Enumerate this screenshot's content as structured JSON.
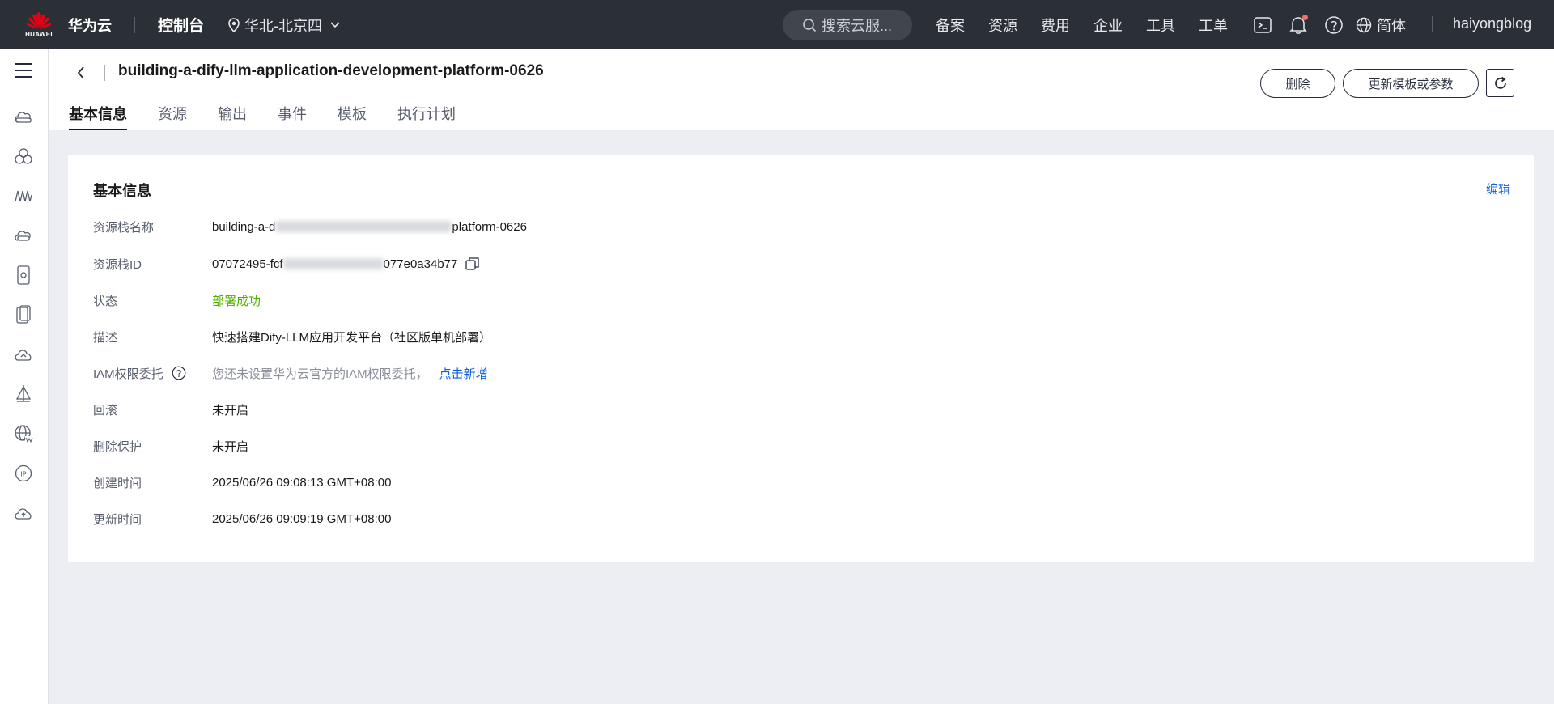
{
  "topbar": {
    "logo_text": "HUAWEI",
    "brand": "华为云",
    "console": "控制台",
    "region": "华北-北京四",
    "search_placeholder": "搜索云服...",
    "nav_links": [
      "备案",
      "资源",
      "费用",
      "企业",
      "工具",
      "工单"
    ],
    "language": "简体",
    "username": "haiyongblog",
    "notification_dot_color": "#f66f6a"
  },
  "sidebar": {
    "icons": [
      "menu-icon",
      "cloud-server-icon",
      "cluster-icon",
      "network-icon",
      "storage-icon",
      "phone-icon",
      "mobile-app-icon",
      "cloud-icon",
      "deploy-icon",
      "globe-icon",
      "ip-icon",
      "cloud-upload-icon"
    ]
  },
  "header": {
    "title": "building-a-dify-llm-application-development-platform-0626",
    "tabs": [
      "基本信息",
      "资源",
      "输出",
      "事件",
      "模板",
      "执行计划"
    ],
    "active_tab": "基本信息",
    "delete_label": "删除",
    "update_label": "更新模板或参数"
  },
  "card": {
    "title": "基本信息",
    "edit_label": "编辑",
    "rows": [
      {
        "label": "资源栈名称",
        "value_prefix": "building-a-d",
        "value_suffix": "platform-0626"
      },
      {
        "label": "资源栈ID",
        "value_prefix": "07072495-fcf",
        "value_suffix": "077e0a34b77"
      },
      {
        "label": "状态",
        "value": "部署成功"
      },
      {
        "label": "描述",
        "value": "快速搭建Dify-LLM应用开发平台（社区版单机部署）"
      },
      {
        "label": "IAM权限委托",
        "value": "您还未设置华为云官方的IAM权限委托，",
        "link": "点击新增"
      },
      {
        "label": "回滚",
        "value": "未开启"
      },
      {
        "label": "删除保护",
        "value": "未开启"
      },
      {
        "label": "创建时间",
        "value": "2025/06/26 09:08:13 GMT+08:00"
      },
      {
        "label": "更新时间",
        "value": "2025/06/26 09:09:19 GMT+08:00"
      }
    ]
  },
  "colors": {
    "topbar_bg": "#2b2f36",
    "success": "#50b000",
    "link": "#0e5fd8"
  }
}
